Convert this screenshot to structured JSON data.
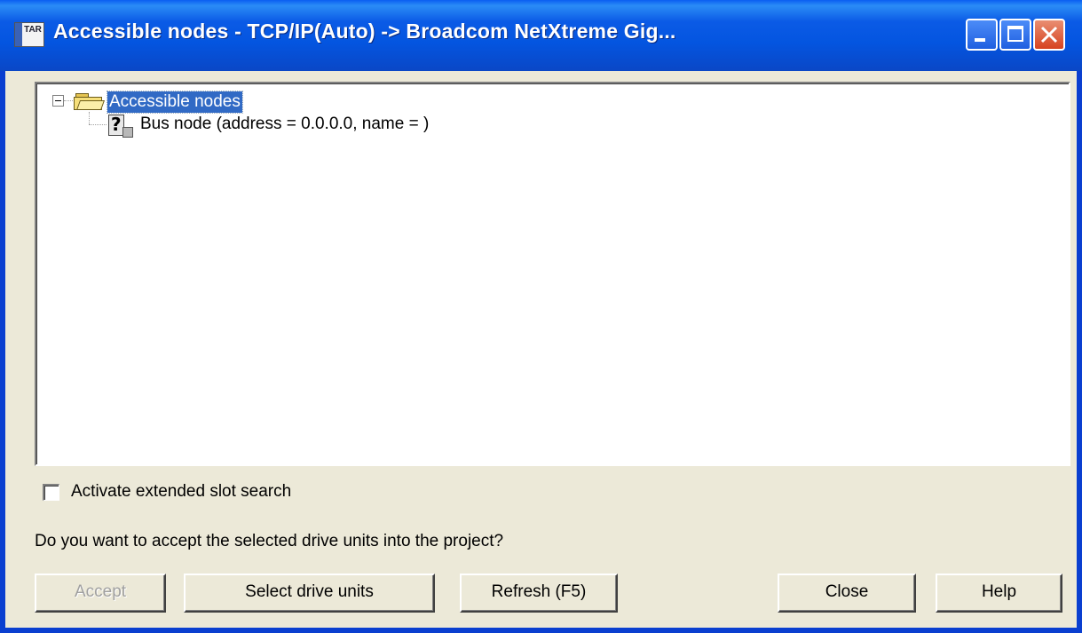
{
  "window": {
    "title": "Accessible nodes - TCP/IP(Auto) -> Broadcom NetXtreme Gig...",
    "app_icon_text": "TAR"
  },
  "tree": {
    "root": {
      "label": "Accessible nodes",
      "expanded": true,
      "selected": true
    },
    "children": [
      {
        "label": "Bus node (address = 0.0.0.0, name = )",
        "icon": "unknown-node-icon"
      }
    ]
  },
  "options": {
    "extended_slot_search_label": "Activate extended slot search",
    "extended_slot_search_checked": false
  },
  "prompt_text": "Do you want to accept the selected drive units into the project?",
  "buttons": {
    "accept": "Accept",
    "select_drive_units": "Select drive units",
    "refresh": "Refresh (F5)",
    "close": "Close",
    "help": "Help"
  }
}
